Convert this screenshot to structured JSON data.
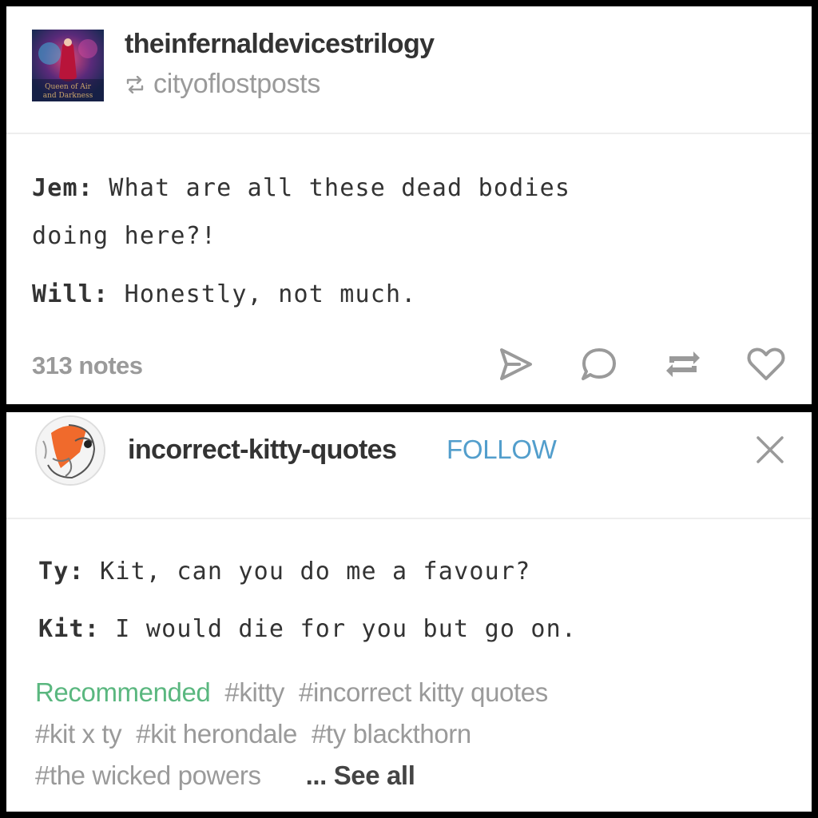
{
  "post1": {
    "blog_name": "theinfernaldevicestrilogy",
    "reblogged_from": "cityoflostposts",
    "avatar_text": [
      "Queen of Air",
      "and Darkness"
    ],
    "lines": [
      {
        "speaker": "Jem:",
        "text": " What are all these dead bodies"
      },
      {
        "speaker": "",
        "text": "doing here?!"
      },
      {
        "speaker": "Will:",
        "text": " Honestly, not much."
      }
    ],
    "notes": "313 notes",
    "actions": [
      "share-icon",
      "reply-icon",
      "reblog-icon",
      "like-icon"
    ]
  },
  "post2": {
    "blog_name": "incorrect-kitty-quotes",
    "follow_label": "FOLLOW",
    "lines": [
      {
        "speaker": "Ty:",
        "text": " Kit, can you do me a favour?"
      },
      {
        "speaker": "Kit:",
        "text": " I would die for you but go on."
      }
    ],
    "recommended_label": "Recommended",
    "tags": [
      "#kitty",
      "#incorrect kitty quotes",
      "#kit x ty",
      "#kit herondale",
      "#ty blackthorn",
      "#the wicked powers"
    ],
    "see_all_label": "... See all"
  },
  "colors": {
    "follow": "#529ecc",
    "recommended": "#5ab77f",
    "muted": "#9a9a9a",
    "text": "#333333"
  }
}
